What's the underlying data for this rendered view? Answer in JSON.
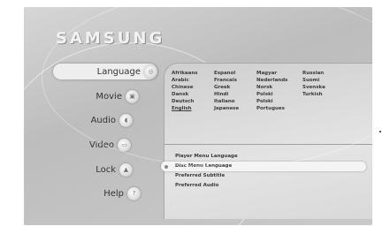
{
  "brand": "SAMSUNG",
  "nav": [
    {
      "label": "Language",
      "icon": "globe-icon",
      "selected": true
    },
    {
      "label": "Movie",
      "icon": "film-icon",
      "selected": false
    },
    {
      "label": "Audio",
      "icon": "speaker-icon",
      "selected": false
    },
    {
      "label": "Video",
      "icon": "monitor-icon",
      "selected": false
    },
    {
      "label": "Lock",
      "icon": "lock-icon",
      "selected": false
    },
    {
      "label": "Help",
      "icon": "help-icon",
      "selected": false
    }
  ],
  "languages": [
    "Afrikaans",
    "Espanol",
    "Magyar",
    "Russian",
    "Arabic",
    "Francais",
    "Nederlands",
    "Suomi",
    "Chinese",
    "Greek",
    "Norsk",
    "Svenska",
    "Dansk",
    "Hindi",
    "Polski",
    "Turkish",
    "Deutsch",
    "Italiano",
    "Polski",
    "",
    "English",
    "Japanese",
    "Portugues",
    ""
  ],
  "current_language": "English",
  "menu": [
    {
      "label": "Player Menu Language",
      "selected": false
    },
    {
      "label": "Disc Menu Language",
      "selected": true
    },
    {
      "label": "Preferred Subtitle",
      "selected": false
    },
    {
      "label": "Preferred Audio",
      "selected": false
    }
  ]
}
